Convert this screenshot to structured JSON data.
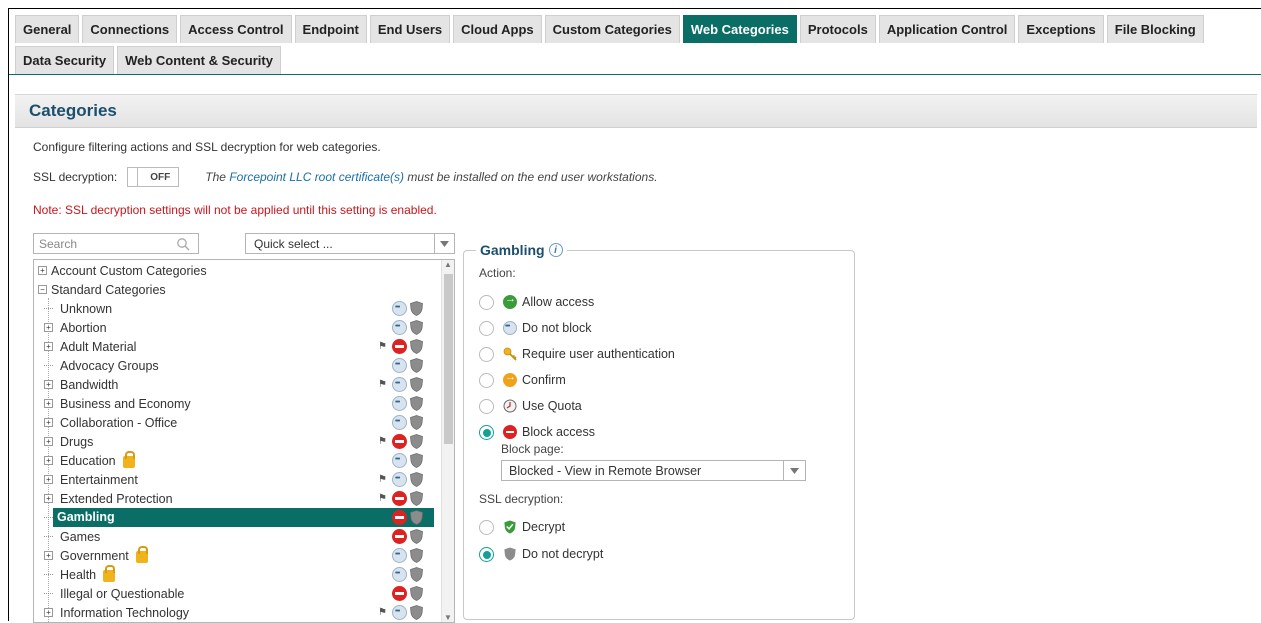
{
  "tabs_row1": [
    "General",
    "Connections",
    "Access Control",
    "Endpoint",
    "End Users",
    "Cloud Apps",
    "Custom Categories",
    "Web Categories",
    "Protocols",
    "Application Control",
    "Exceptions",
    "File Blocking"
  ],
  "tabs_row2": [
    "Data Security",
    "Web Content & Security"
  ],
  "active_tab": "Web Categories",
  "header": {
    "title": "Categories"
  },
  "description": "Configure filtering actions and SSL decryption for web categories.",
  "ssl": {
    "label": "SSL decryption:",
    "toggle": "OFF",
    "note_prefix": "The",
    "note_link": "Forcepoint LLC root certificate(s)",
    "note_suffix": "must be installed on the end user workstations."
  },
  "warning": "Note: SSL decryption settings will not be applied until this setting is enabled.",
  "search": {
    "placeholder": "Search"
  },
  "quick_select": {
    "value": "Quick select ..."
  },
  "tree": {
    "roots": [
      "Account Custom Categories",
      "Standard Categories"
    ],
    "items": [
      {
        "label": "Unknown",
        "expandable": false,
        "flag": false,
        "action": "nb",
        "lock": false
      },
      {
        "label": "Abortion",
        "expandable": true,
        "flag": false,
        "action": "nb",
        "lock": false
      },
      {
        "label": "Adult Material",
        "expandable": true,
        "flag": true,
        "action": "bl",
        "lock": false
      },
      {
        "label": "Advocacy Groups",
        "expandable": false,
        "flag": false,
        "action": "nb",
        "lock": false
      },
      {
        "label": "Bandwidth",
        "expandable": true,
        "flag": true,
        "action": "nb",
        "lock": false
      },
      {
        "label": "Business and Economy",
        "expandable": true,
        "flag": false,
        "action": "nb",
        "lock": false
      },
      {
        "label": "Collaboration - Office",
        "expandable": true,
        "flag": false,
        "action": "nb",
        "lock": false
      },
      {
        "label": "Drugs",
        "expandable": true,
        "flag": true,
        "action": "bl",
        "lock": false
      },
      {
        "label": "Education",
        "expandable": true,
        "flag": false,
        "action": "nb",
        "lock": true
      },
      {
        "label": "Entertainment",
        "expandable": true,
        "flag": true,
        "action": "nb",
        "lock": false
      },
      {
        "label": "Extended Protection",
        "expandable": true,
        "flag": true,
        "action": "bl",
        "lock": false
      },
      {
        "label": "Gambling",
        "expandable": false,
        "flag": false,
        "action": "bl",
        "lock": false,
        "selected": true
      },
      {
        "label": "Games",
        "expandable": false,
        "flag": false,
        "action": "bl",
        "lock": false
      },
      {
        "label": "Government",
        "expandable": true,
        "flag": false,
        "action": "nb",
        "lock": true
      },
      {
        "label": "Health",
        "expandable": false,
        "flag": false,
        "action": "nb",
        "lock": true
      },
      {
        "label": "Illegal or Questionable",
        "expandable": false,
        "flag": false,
        "action": "bl",
        "lock": false
      },
      {
        "label": "Information Technology",
        "expandable": true,
        "flag": true,
        "action": "nb",
        "lock": false
      }
    ]
  },
  "panel": {
    "title": "Gambling",
    "action_label": "Action:",
    "options": [
      {
        "label": "Allow access",
        "icon": "allow",
        "selected": false
      },
      {
        "label": "Do not block",
        "icon": "nb",
        "selected": false
      },
      {
        "label": "Require user authentication",
        "icon": "key",
        "selected": false
      },
      {
        "label": "Confirm",
        "icon": "confirm",
        "selected": false
      },
      {
        "label": "Use Quota",
        "icon": "quota",
        "selected": false
      },
      {
        "label": "Block access",
        "icon": "block",
        "selected": true
      }
    ],
    "block_page_label": "Block page:",
    "block_page_value": "Blocked - View in Remote Browser",
    "ssl_label": "SSL decryption:",
    "ssl_options": [
      {
        "label": "Decrypt",
        "icon": "dec-green",
        "selected": false
      },
      {
        "label": "Do not decrypt",
        "icon": "dec-gray",
        "selected": true
      }
    ]
  },
  "colors": {
    "accent": "#0a6e66",
    "header_text": "#1c4e6e",
    "warning": "#c8161d",
    "link": "#1a6fa8",
    "radio_on": "#12a195"
  }
}
